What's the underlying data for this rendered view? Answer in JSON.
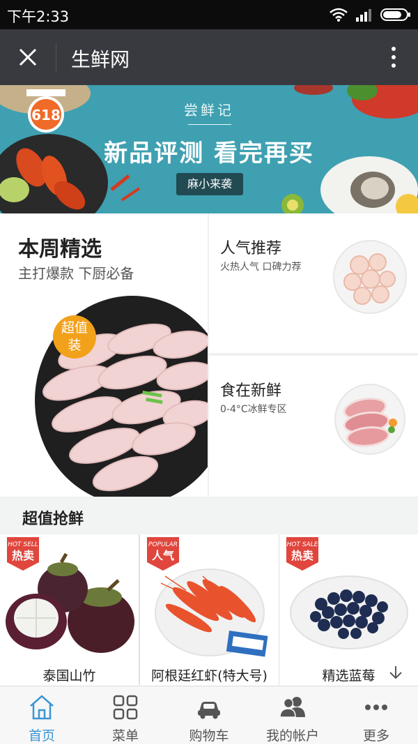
{
  "status_bar": {
    "time": "下午2:33"
  },
  "nav": {
    "title": "生鲜网"
  },
  "banner": {
    "subtitle": "尝鲜记",
    "title": "新品评测 看完再买",
    "tag": "麻小来袭",
    "badge": "618"
  },
  "promo": {
    "left": {
      "title": "本周精选",
      "subtitle": "主打爆款 下厨必备",
      "badge": "超值装"
    },
    "right_top": {
      "title": "人气推荐",
      "subtitle": "火热人气 口碑力荐"
    },
    "right_bottom": {
      "title": "食在新鲜",
      "subtitle": "0-4°C冰鲜专区"
    }
  },
  "section": {
    "title": "超值抢鲜"
  },
  "products": [
    {
      "name": "泰国山竹",
      "tag_en": "HOT SELL",
      "tag_cn": "热卖"
    },
    {
      "name": "阿根廷红虾(特大号)",
      "tag_en": "POPULAR",
      "tag_cn": "人气"
    },
    {
      "name": "精选蓝莓",
      "tag_en": "HOT SALE",
      "tag_cn": "热卖"
    }
  ],
  "tabbar": {
    "items": [
      {
        "label": "首页",
        "icon": "home-icon",
        "active": true
      },
      {
        "label": "菜单",
        "icon": "grid-icon",
        "active": false
      },
      {
        "label": "购物车",
        "icon": "car-icon",
        "active": false
      },
      {
        "label": "我的帐户",
        "icon": "users-icon",
        "active": false
      },
      {
        "label": "更多",
        "icon": "more-icon",
        "active": false
      }
    ]
  },
  "colors": {
    "nav_bg": "#393a3f",
    "banner_bg": "#3ea0b1",
    "active_tab": "#3a95d6",
    "tag_red": "#e0463d",
    "badge_orange": "#f2a11b"
  }
}
